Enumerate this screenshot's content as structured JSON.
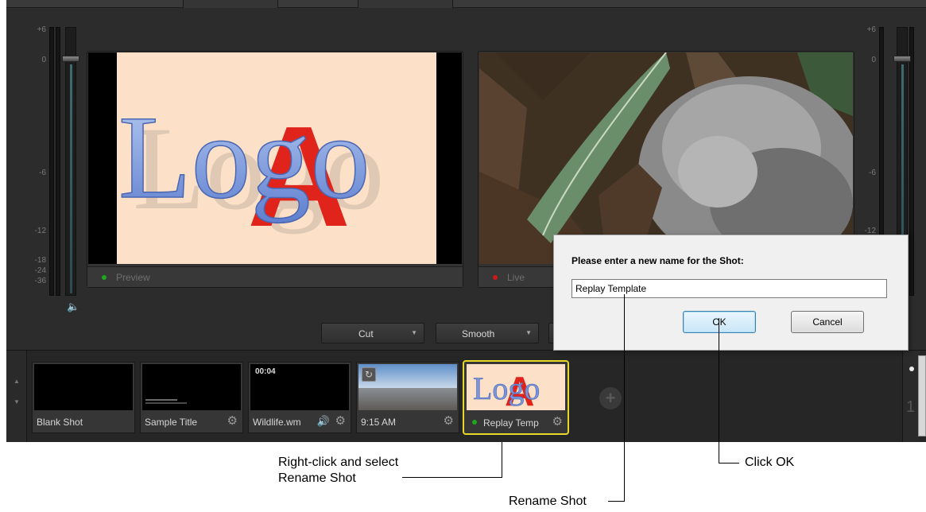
{
  "meters": {
    "left_scale": [
      "+6",
      "0",
      "-6",
      "-12",
      "-18",
      "-24",
      "-36"
    ],
    "right_scale": [
      "+6",
      "0",
      "-6",
      "-12"
    ]
  },
  "preview": {
    "label": "Preview",
    "status_color": "#1fa51f",
    "logo_text": "Logo",
    "logo_accent": "A"
  },
  "live": {
    "label": "Live",
    "status_color": "#cc1a1a"
  },
  "transitions": {
    "cut_label": "Cut",
    "smooth_label": "Smooth"
  },
  "shots": [
    {
      "name": "Blank Shot",
      "overlay": ""
    },
    {
      "name": "Sample Title",
      "overlay": ""
    },
    {
      "name": "Wildlife.wm",
      "overlay": "00:04"
    },
    {
      "name": "9:15 AM",
      "overlay": ""
    },
    {
      "name": "Replay Temp",
      "overlay": ""
    }
  ],
  "bin": {
    "page_number": "1"
  },
  "dialog": {
    "prompt": "Please enter a new name for the Shot:",
    "input_value": "Replay Template",
    "ok_label": "OK",
    "cancel_label": "Cancel"
  },
  "callouts": {
    "right_click": "Right-click and select\nRename Shot",
    "rename_shot": "Rename Shot",
    "click_ok": "Click OK"
  },
  "colors": {
    "selected_border": "#e6d72a",
    "accent_dot_green": "#1fa51f"
  }
}
